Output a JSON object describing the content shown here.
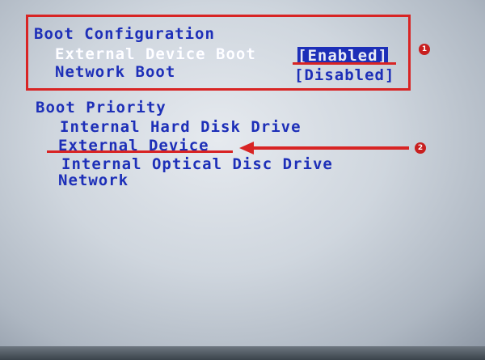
{
  "boot_configuration": {
    "heading": "Boot Configuration",
    "items": [
      {
        "label": "External Device Boot",
        "value": "[Enabled]",
        "selected": true
      },
      {
        "label": "Network Boot",
        "value": "[Disabled]",
        "selected": false
      }
    ]
  },
  "boot_priority": {
    "heading": "Boot Priority",
    "items": [
      "Internal Hard Disk Drive",
      "External Device",
      "Internal Optical Disc Drive",
      "Network"
    ]
  },
  "annotations": {
    "badge_1": "1",
    "badge_2": "2",
    "color": "#d82424"
  }
}
